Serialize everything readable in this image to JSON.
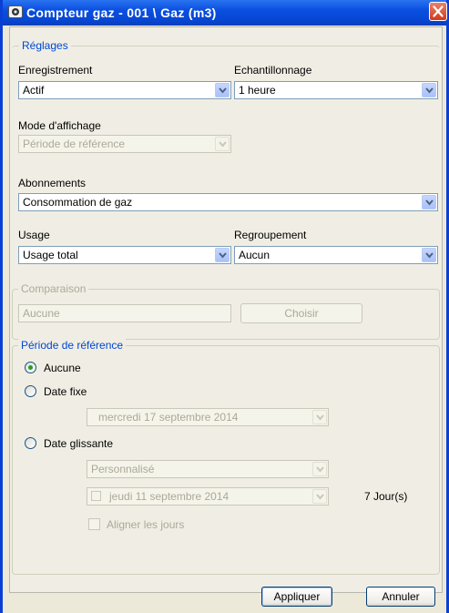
{
  "window": {
    "title": "Compteur gaz - 001 \\ Gaz (m3)"
  },
  "reglages": {
    "legend": "Réglages",
    "enregistrement_label": "Enregistrement",
    "enregistrement_value": "Actif",
    "echantillonnage_label": "Echantillonnage",
    "echantillonnage_value": "1 heure",
    "mode_label": "Mode d'affichage",
    "mode_value": "Période de référence",
    "abonnements_label": "Abonnements",
    "abonnements_value": "Consommation de gaz",
    "usage_label": "Usage",
    "usage_value": "Usage total",
    "regroupement_label": "Regroupement",
    "regroupement_value": "Aucun"
  },
  "comparaison": {
    "legend": "Comparaison",
    "value": "Aucune",
    "choose_label": "Choisir"
  },
  "periode": {
    "legend": "Période de référence",
    "radio_aucune": "Aucune",
    "radio_date_fixe": "Date fixe",
    "date_fixe_value": "mercredi  17 septembre 2014",
    "radio_date_glissante": "Date glissante",
    "glissante_mode_value": "Personnalisé",
    "glissante_date_value": "jeudi    11 septembre 2014",
    "jours_text": "7 Jour(s)",
    "aligner_label": "Aligner les jours",
    "selected": "aucune"
  },
  "footer": {
    "apply_label": "Appliquer",
    "cancel_label": "Annuler"
  },
  "colors": {
    "title_bar": "#0a4fe0",
    "legend_text": "#0046d5",
    "disabled_text": "#aca899",
    "radio_dot": "#21a121",
    "close_button": "#d4391c"
  }
}
